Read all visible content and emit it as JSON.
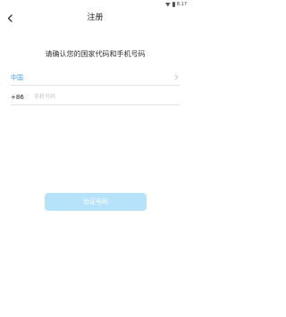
{
  "status_bar": {
    "time": "8:17",
    "icons": [
      "wifi-icon",
      "battery-icon"
    ]
  },
  "header": {
    "back_icon": "chevron-left-icon",
    "title": "注册"
  },
  "instruction": "请确认您的国家代码和手机号码",
  "country": {
    "value": "中国",
    "icon": "chevron-right-icon"
  },
  "phone": {
    "country_code": "+86",
    "placeholder": "手机号码",
    "value": ""
  },
  "verify_button": {
    "label": "验证号码"
  },
  "colors": {
    "accent": "#3c9ee8",
    "button_bg": "#b7e3fa",
    "divider": "#e3e3e3",
    "placeholder": "#c4c4c4"
  }
}
